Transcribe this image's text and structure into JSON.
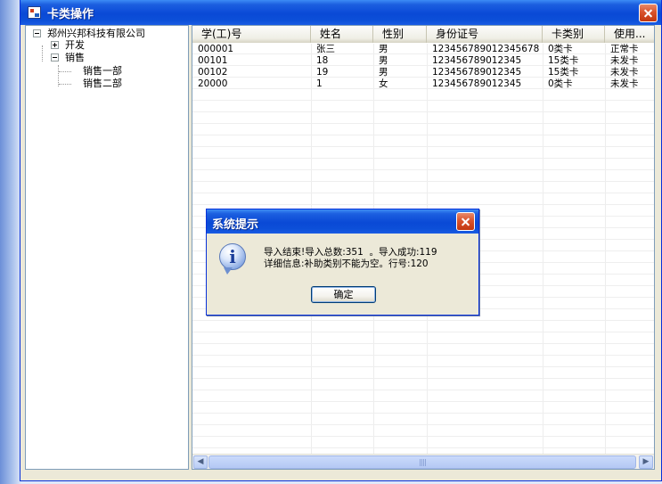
{
  "window": {
    "title": "卡类操作"
  },
  "tree": {
    "root": "郑州兴邦科技有限公司",
    "nodes": [
      {
        "label": "开发",
        "expanded": false
      },
      {
        "label": "销售",
        "expanded": true,
        "children": [
          "销售一部",
          "销售二部"
        ]
      }
    ]
  },
  "grid": {
    "columns": [
      "学(工)号",
      "姓名",
      "性别",
      "身份证号",
      "卡类别",
      "使用..."
    ],
    "rows": [
      [
        "000001",
        "张三",
        "男",
        "123456789012345678",
        "0类卡",
        "正常卡"
      ],
      [
        "00101",
        "18",
        "男",
        "123456789012345",
        "15类卡",
        "未发卡"
      ],
      [
        "00102",
        "19",
        "男",
        "123456789012345",
        "15类卡",
        "未发卡"
      ],
      [
        "20000",
        "1",
        "女",
        "123456789012345",
        "0类卡",
        "未发卡"
      ]
    ]
  },
  "dialog": {
    "title": "系统提示",
    "line1": "导入结束!导入总数:351  。导入成功:119",
    "line2": "详细信息:补助类别不能为空。行号:120",
    "ok_label": "确定",
    "icon": "info-icon"
  },
  "colors": {
    "titlebar": "#0a49d6",
    "close": "#d9532c",
    "window_bg": "#ece9d8"
  }
}
